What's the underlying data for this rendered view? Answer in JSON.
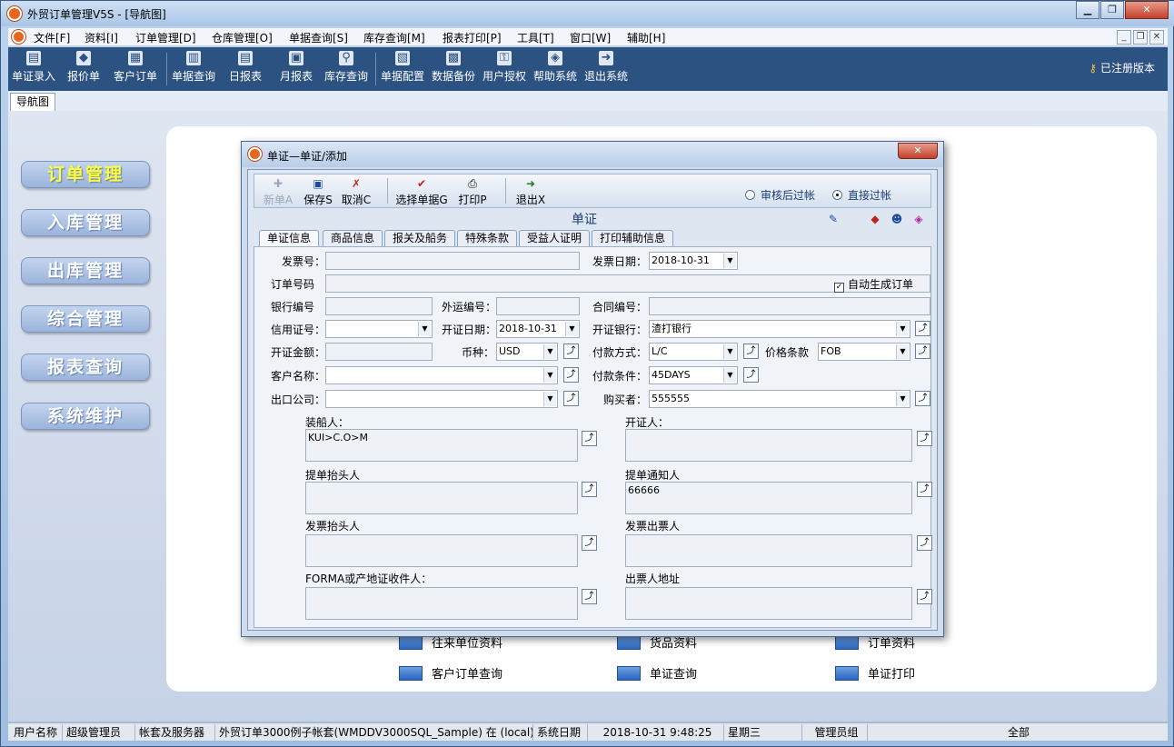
{
  "window": {
    "title": "外贸订单管理V5S - [导航图]"
  },
  "menu": [
    "文件[F]",
    "资料[I]",
    "订单管理[D]",
    "仓库管理[O]",
    "单据查询[S]",
    "库存查询[M]",
    "报表打印[P]",
    "工具[T]",
    "窗口[W]",
    "辅助[H]"
  ],
  "toolbar": {
    "items": [
      {
        "label": "单证录入",
        "icon": "document-entry-icon"
      },
      {
        "label": "报价单",
        "icon": "quote-icon"
      },
      {
        "label": "客户订单",
        "icon": "customer-order-icon"
      },
      {
        "label": "单据查询",
        "icon": "document-query-icon"
      },
      {
        "label": "日报表",
        "icon": "daily-report-icon"
      },
      {
        "label": "月报表",
        "icon": "monthly-report-icon"
      },
      {
        "label": "库存查询",
        "icon": "inventory-search-icon"
      },
      {
        "label": "单据配置",
        "icon": "config-icon"
      },
      {
        "label": "数据备份",
        "icon": "backup-icon"
      },
      {
        "label": "用户授权",
        "icon": "user-auth-icon"
      },
      {
        "label": "帮助系统",
        "icon": "help-icon"
      },
      {
        "label": "退出系统",
        "icon": "exit-icon"
      }
    ],
    "registered": "已注册版本"
  },
  "tabs": {
    "nav": "导航图"
  },
  "nav": [
    "订单管理",
    "入库管理",
    "出库管理",
    "综合管理",
    "报表查询",
    "系统维护"
  ],
  "quick_links": [
    "往来单位资料",
    "货品资料",
    "订单资料",
    "客户订单查询",
    "单证查询",
    "单证打印"
  ],
  "status": {
    "user_label": "用户名称",
    "user": "超级管理员",
    "account_label": "帐套及服务器",
    "account": "外贸订单3000例子帐套(WMDDV3000SQL_Sample) 在 (local) _",
    "date_label": "系统日期",
    "datetime": "2018-10-31  9:48:25",
    "weekday": "星期三",
    "group": "管理员组",
    "scope": "全部"
  },
  "dialog": {
    "title": "单证—单证/添加",
    "tools": {
      "new": "新单A",
      "save": "保存S",
      "cancel": "取消C",
      "select": "选择单据G",
      "print": "打印P",
      "exit": "退出X"
    },
    "radio": {
      "audit": "审核后过帐",
      "direct": "直接过帐"
    },
    "subtitle": "单证",
    "tabs": [
      "单证信息",
      "商品信息",
      "报关及船务",
      "特殊条款",
      "受益人证明",
      "打印辅助信息"
    ],
    "form": {
      "invoice_no": "发票号：",
      "invoice_date": "发票日期：",
      "invoice_date_val": "2018-10-31",
      "order_no": "订单号码",
      "auto_order": "自动生成订单",
      "bank_no": "银行编号",
      "ship_no": "外运编号：",
      "contract_no": "合同编号：",
      "lc_no": "信用证号：",
      "issue_date": "开证日期：",
      "issue_date_val": "2018-10-31",
      "issue_bank": "开证银行：",
      "issue_bank_val": "渣打银行",
      "amount": "开证金额：",
      "currency": "币种：",
      "currency_val": "USD",
      "pay_method": "付款方式：",
      "pay_method_val": "L/C",
      "price_terms": "价格条款",
      "price_terms_val": "FOB",
      "customer": "客户名称：",
      "pay_terms": "付款条件：",
      "pay_terms_val": "45DAYS",
      "export_co": "出口公司：",
      "buyer": "购买者：",
      "buyer_val": "555555",
      "shipper": "装船人：",
      "shipper_val": "KUI>C.O>M",
      "issuer": "开证人：",
      "bl_header": "提单抬头人",
      "notify": "提单通知人",
      "notify_val": "66666",
      "inv_header": "发票抬头人",
      "inv_issuer": "发票出票人",
      "forma": "FORMA或产地证收件人：",
      "drawer_addr": "出票人地址"
    }
  }
}
